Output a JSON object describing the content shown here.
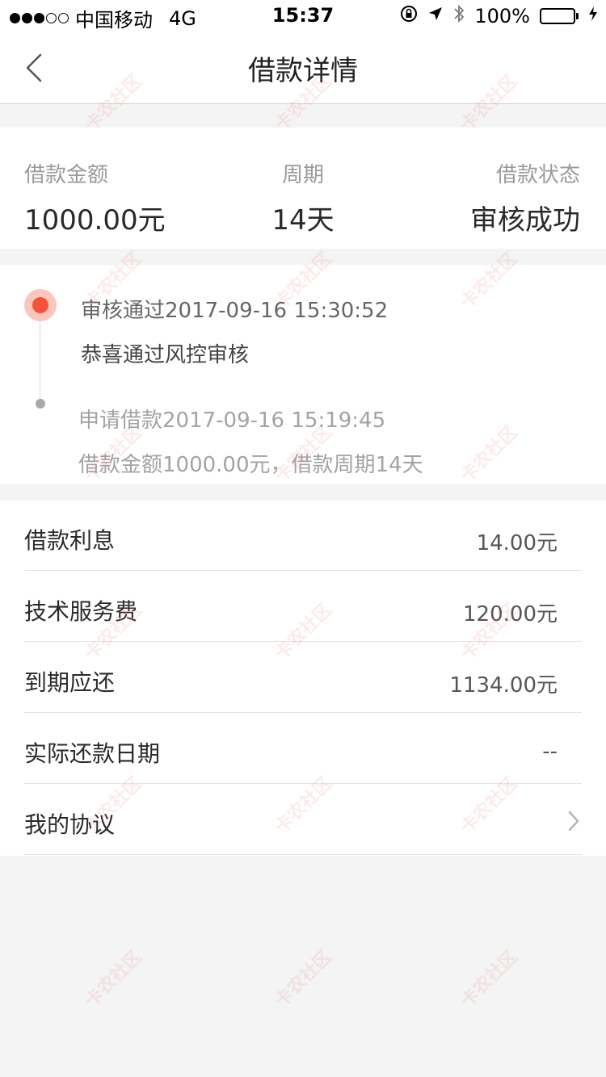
{
  "status_bar": {
    "carrier": "中国移动",
    "network": "4G",
    "time": "15:37",
    "battery": "100%",
    "battery_color": "#4cd964"
  },
  "nav": {
    "title": "借款详情",
    "back_icon": "chevron-left-icon"
  },
  "summary": {
    "amount_label": "借款金额",
    "amount_value": "1000.00元",
    "period_label": "周期",
    "period_value": "14天",
    "status_label": "借款状态",
    "status_value": "审核成功"
  },
  "timeline": {
    "items": [
      {
        "title": "审核通过2017-09-16 15:30:52",
        "desc": "恭喜通过风控审核",
        "active": true
      },
      {
        "title": "申请借款2017-09-16 15:19:45",
        "desc": "借款金额1000.00元，借款周期14天",
        "active": false
      }
    ],
    "active_color": "#f4533a"
  },
  "details": {
    "rows": [
      {
        "label": "借款利息",
        "value": "14.00元"
      },
      {
        "label": "技术服务费",
        "value": "120.00元"
      },
      {
        "label": "到期应还",
        "value": "1134.00元"
      },
      {
        "label": "实际还款日期",
        "value": "--"
      },
      {
        "label": "我的协议",
        "value": ""
      }
    ]
  },
  "watermark": {
    "text": "卡农社区"
  }
}
